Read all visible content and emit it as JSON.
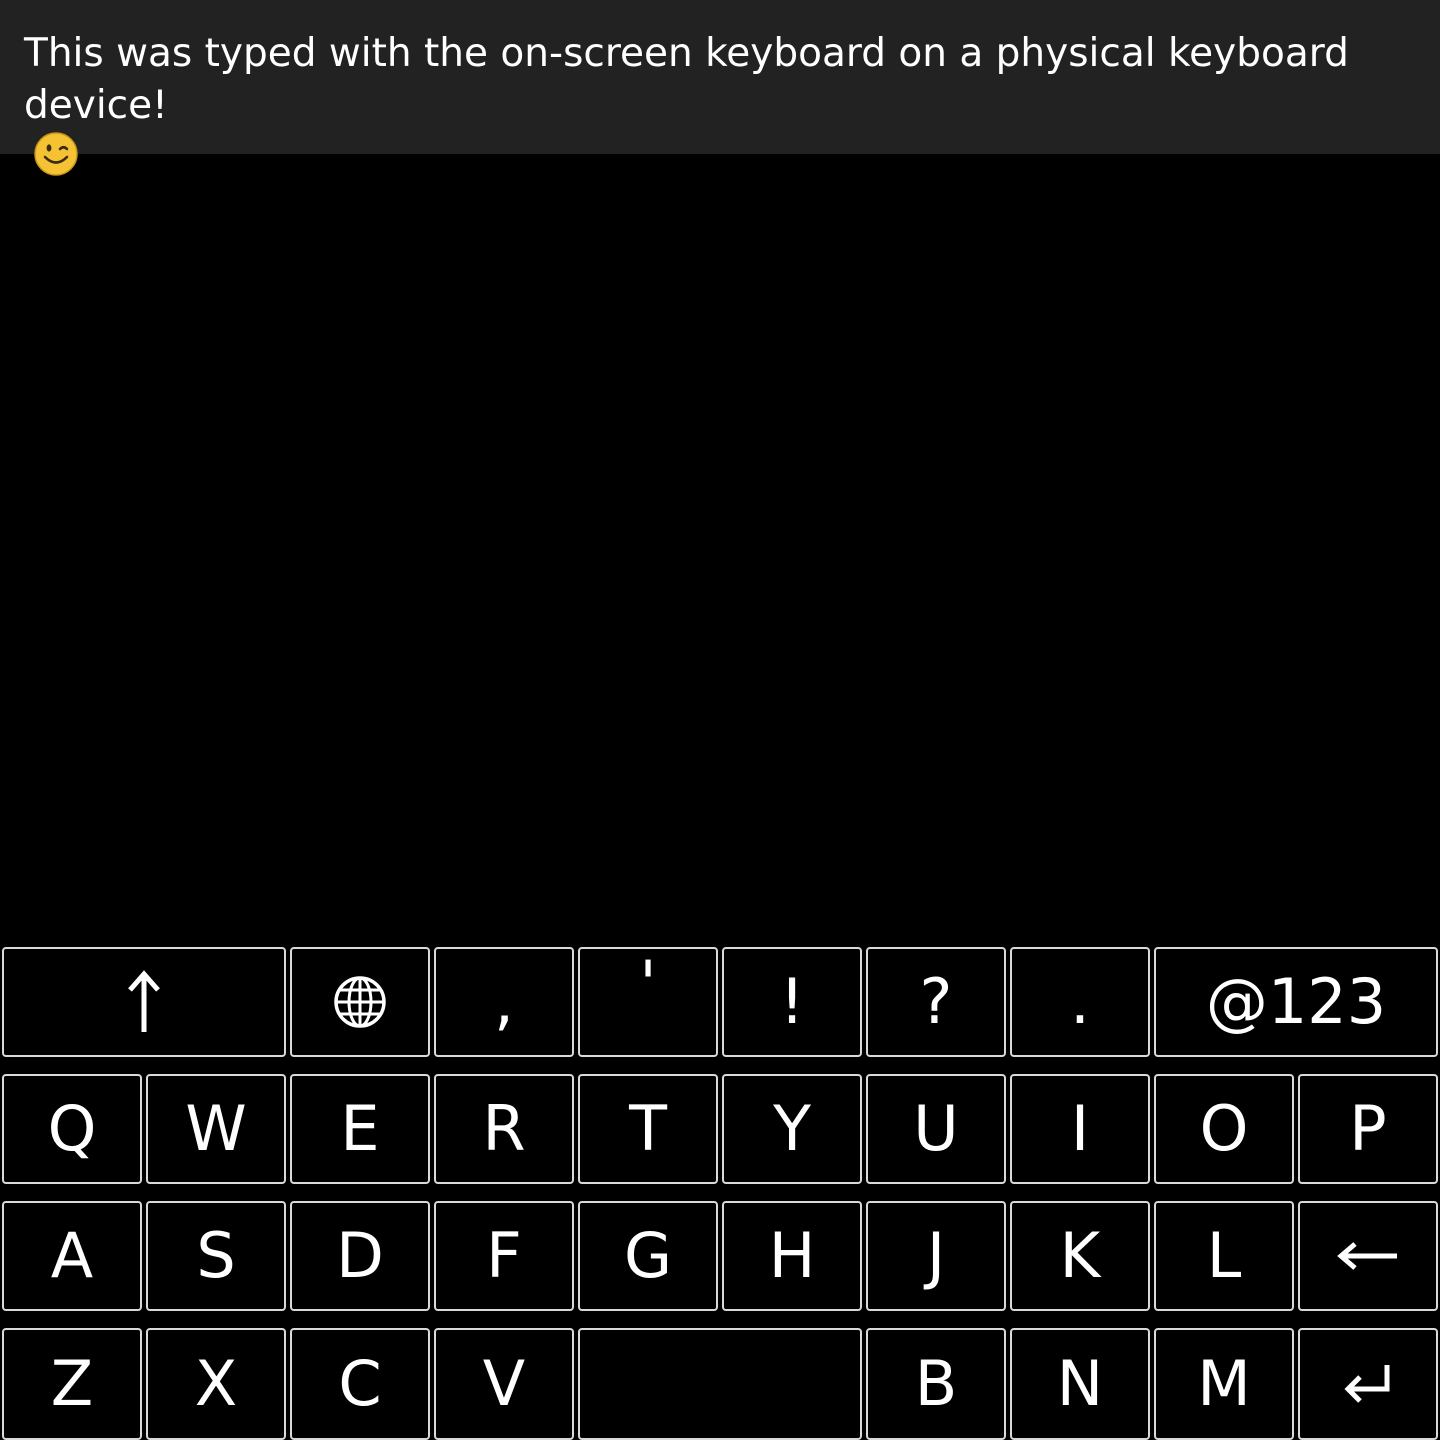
{
  "text_field": {
    "value": "This was typed with the on-screen keyboard on a physical keyboard device!",
    "emoji_icon": "winking-smiley-emoji",
    "emoji_color": "#f5c233"
  },
  "keyboard": {
    "row1": {
      "shift_icon": "shift-arrow-icon",
      "language_icon": "globe-icon",
      "comma": ",",
      "apostrophe": "'",
      "exclamation": "!",
      "question": "?",
      "period": ".",
      "symbols": "@123"
    },
    "row2": [
      "Q",
      "W",
      "E",
      "R",
      "T",
      "Y",
      "U",
      "I",
      "O",
      "P"
    ],
    "row3": [
      "A",
      "S",
      "D",
      "F",
      "G",
      "H",
      "J",
      "K",
      "L"
    ],
    "row3_backspace_icon": "backspace-arrow-icon",
    "row4_left": [
      "Z",
      "X",
      "C",
      "V"
    ],
    "row4_space_icon": "space-bar",
    "row4_right": [
      "B",
      "N",
      "M"
    ],
    "row4_enter_icon": "enter-icon"
  },
  "colors": {
    "background": "#000000",
    "text_area_bg": "#222222",
    "key_border": "#d9d9d9",
    "text": "#ffffff"
  }
}
